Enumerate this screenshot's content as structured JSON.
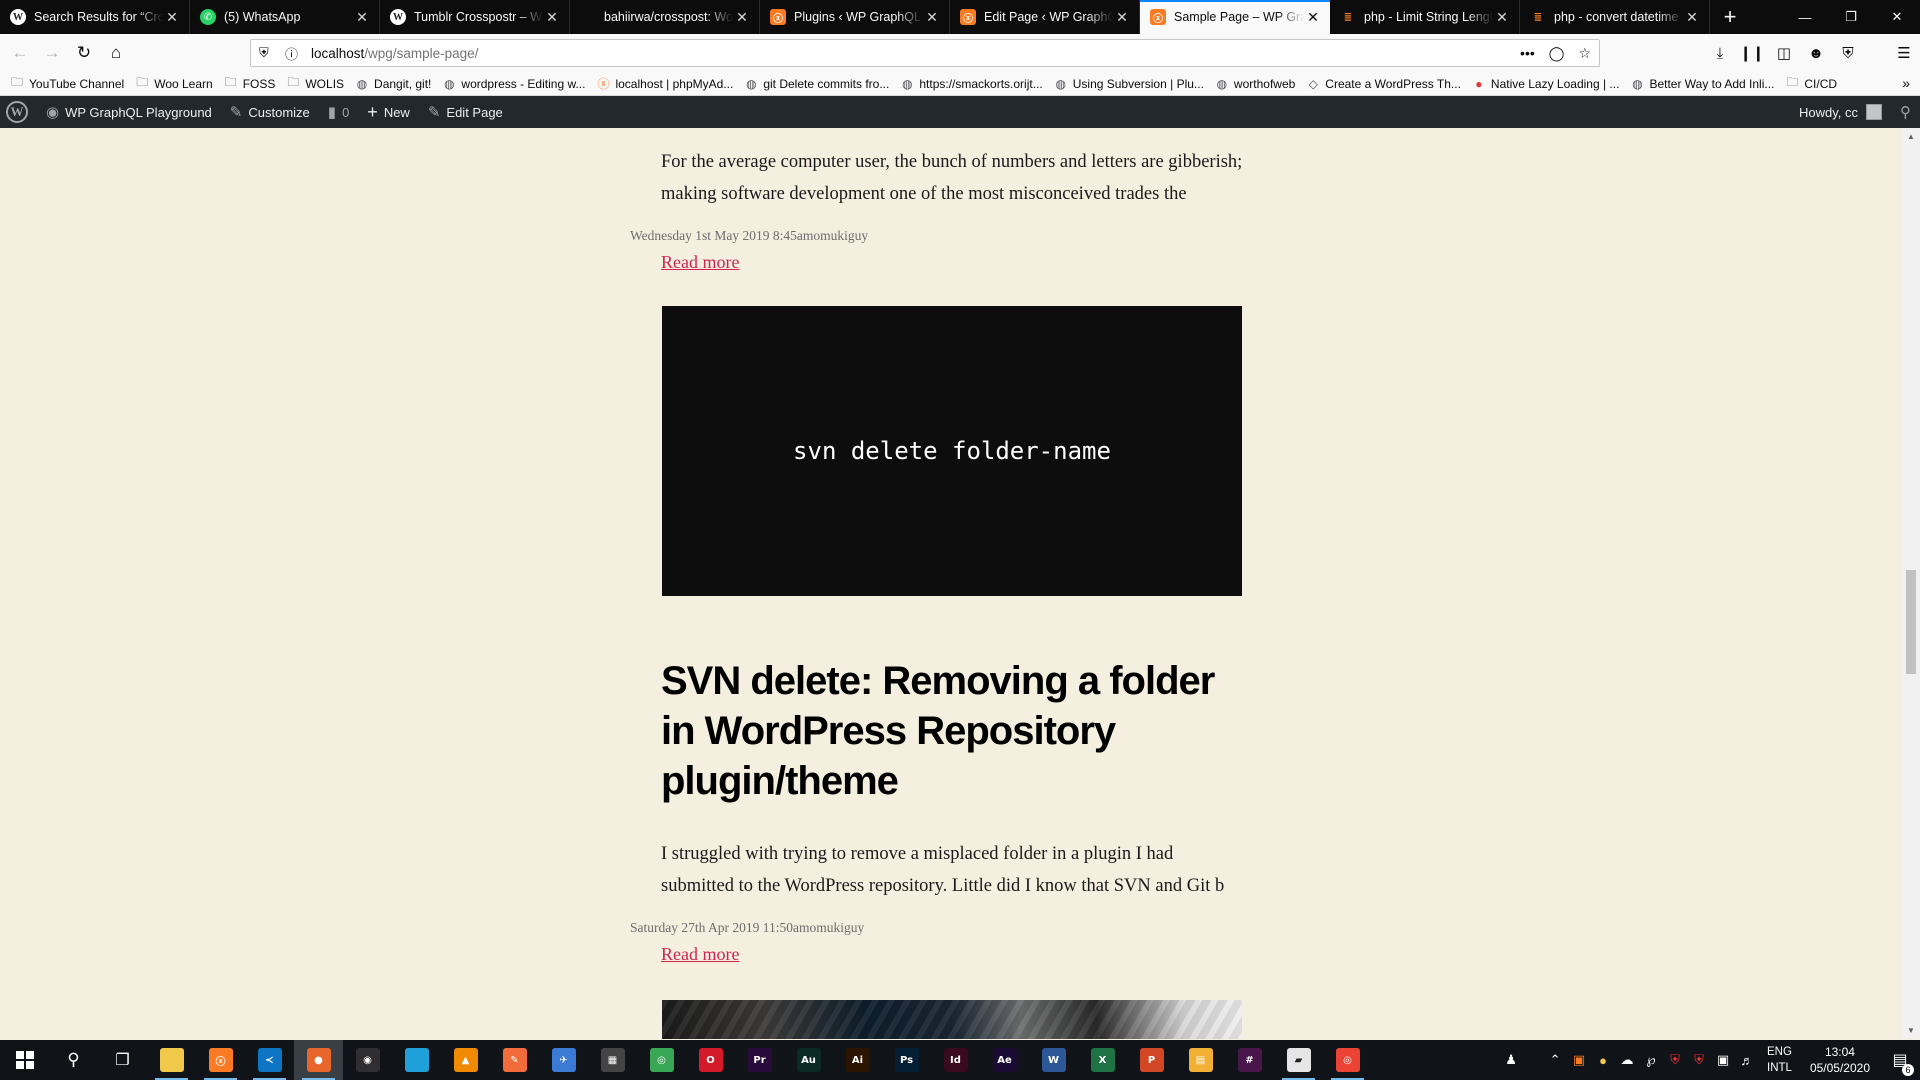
{
  "browser": {
    "tabs": [
      {
        "title": "Search Results for “Cros…",
        "favicon": "wordpress-icon",
        "active": false
      },
      {
        "title": "(5) WhatsApp",
        "favicon": "whatsapp-icon",
        "active": false
      },
      {
        "title": "Tumblr Crosspostr – Wo…",
        "favicon": "wordpress-icon",
        "active": false
      },
      {
        "title": "bahiirwa/crosspost: Wor…",
        "favicon": "github-icon",
        "active": false
      },
      {
        "title": "Plugins ‹ WP GraphQL P…",
        "favicon": "xampp-icon",
        "active": false
      },
      {
        "title": "Edit Page ‹ WP GraphQL…",
        "favicon": "xampp-icon",
        "active": false
      },
      {
        "title": "Sample Page – WP Grap…",
        "favicon": "xampp-icon",
        "active": true
      },
      {
        "title": "php - Limit String Lengt…",
        "favicon": "stackoverflow-icon",
        "active": false
      },
      {
        "title": "php - convert datetime t…",
        "favicon": "stackoverflow-icon",
        "active": false
      }
    ],
    "new_tab_label": "+",
    "url": {
      "host": "localhost",
      "path": "/wpg/sample-page/"
    },
    "url_actions": {
      "more": "•••"
    },
    "bookmarks": [
      {
        "label": "YouTube Channel",
        "icon": "folder-icon"
      },
      {
        "label": "Woo Learn",
        "icon": "folder-icon"
      },
      {
        "label": "FOSS",
        "icon": "folder-icon"
      },
      {
        "label": "WOLIS",
        "icon": "folder-icon"
      },
      {
        "label": "Dangit, git!",
        "icon": "globe-icon"
      },
      {
        "label": "wordpress - Editing w...",
        "icon": "globe-icon"
      },
      {
        "label": "localhost | phpMyAd...",
        "icon": "xampp-icon"
      },
      {
        "label": "git Delete commits fro...",
        "icon": "globe-icon"
      },
      {
        "label": "https://smackorts.orijt...",
        "icon": "globe-icon"
      },
      {
        "label": "Using Subversion | Plu...",
        "icon": "globe-icon"
      },
      {
        "label": "worthofweb",
        "icon": "globe-icon"
      },
      {
        "label": "Create a WordPress Th...",
        "icon": "codepen-icon"
      },
      {
        "label": "Native Lazy Loading | ...",
        "icon": "red-circle-icon"
      },
      {
        "label": "Better Way to Add Inli...",
        "icon": "globe-icon"
      },
      {
        "label": "CI/CD",
        "icon": "folder-icon"
      }
    ]
  },
  "adminbar": {
    "site_name": "WP GraphQL Playground",
    "customize": "Customize",
    "comments_count": "0",
    "new": "New",
    "edit_page": "Edit Page",
    "howdy": "Howdy, cc"
  },
  "page": {
    "post1": {
      "excerpt": "For the average computer user, the bunch of numbers and letters are gibberish; making software development one of the most misconceived trades the",
      "meta": "Wednesday 1st May 2019 8:45amomukiguy",
      "read_more": "Read more"
    },
    "code": "svn delete folder-name",
    "post2": {
      "title": "SVN delete: Removing a folder in WordPress Repository plugin/theme",
      "excerpt": "I struggled with trying to remove a misplaced folder in a plugin I had submitted to the WordPress repository. Little did I know that SVN and Git b",
      "meta": "Saturday 27th Apr 2019 11:50amomukiguy",
      "read_more": "Read more"
    }
  },
  "taskbar": {
    "apps": [
      {
        "name": "file-explorer",
        "abbr": "",
        "color": "#f2c84b",
        "running": true
      },
      {
        "name": "xampp",
        "abbr": "ⓧ",
        "color": "#fb7a24",
        "running": true
      },
      {
        "name": "vscode",
        "abbr": "≺",
        "color": "#0e74c4",
        "running": true
      },
      {
        "name": "firefox",
        "abbr": "●",
        "color": "#e8662c",
        "running": true,
        "active": true
      },
      {
        "name": "obs",
        "abbr": "◉",
        "color": "#302e31",
        "running": false
      },
      {
        "name": "edge-like",
        "abbr": "",
        "color": "#1fa0d8",
        "running": false
      },
      {
        "name": "vlc",
        "abbr": "▲",
        "color": "#f08a00",
        "running": false
      },
      {
        "name": "postman",
        "abbr": "✎",
        "color": "#f26b3a",
        "running": false
      },
      {
        "name": "plane",
        "abbr": "✈",
        "color": "#3b7bd6",
        "running": false
      },
      {
        "name": "calculator",
        "abbr": "▦",
        "color": "#444",
        "running": false
      },
      {
        "name": "chrome",
        "abbr": "◎",
        "color": "#3aa757",
        "running": false
      },
      {
        "name": "opera",
        "abbr": "O",
        "color": "#d21a2b",
        "running": false
      },
      {
        "name": "premiere",
        "abbr": "Pr",
        "color": "#2a0a3a",
        "running": false
      },
      {
        "name": "audition",
        "abbr": "Au",
        "color": "#0b2a26",
        "running": false
      },
      {
        "name": "illustrator",
        "abbr": "Ai",
        "color": "#2b1400",
        "running": false
      },
      {
        "name": "photoshop",
        "abbr": "Ps",
        "color": "#061e33",
        "running": false
      },
      {
        "name": "indesign",
        "abbr": "Id",
        "color": "#3a0a1e",
        "running": false
      },
      {
        "name": "after-effects",
        "abbr": "Ae",
        "color": "#1b0a33",
        "running": false
      },
      {
        "name": "word",
        "abbr": "W",
        "color": "#2b5797",
        "running": false
      },
      {
        "name": "excel",
        "abbr": "X",
        "color": "#1f7244",
        "running": false
      },
      {
        "name": "powerpoint",
        "abbr": "P",
        "color": "#d24726",
        "running": false
      },
      {
        "name": "sticky",
        "abbr": "▤",
        "color": "#f2b134",
        "running": false
      },
      {
        "name": "slack",
        "abbr": "#",
        "color": "#4a154b",
        "running": false
      },
      {
        "name": "notes",
        "abbr": "▰",
        "color": "#e6e6e6",
        "running": true
      },
      {
        "name": "chrome-2",
        "abbr": "◎",
        "color": "#ea4335",
        "running": true
      }
    ],
    "lang_top": "ENG",
    "lang_bottom": "INTL",
    "time": "13:04",
    "date": "05/05/2020",
    "notification_count": "6"
  }
}
